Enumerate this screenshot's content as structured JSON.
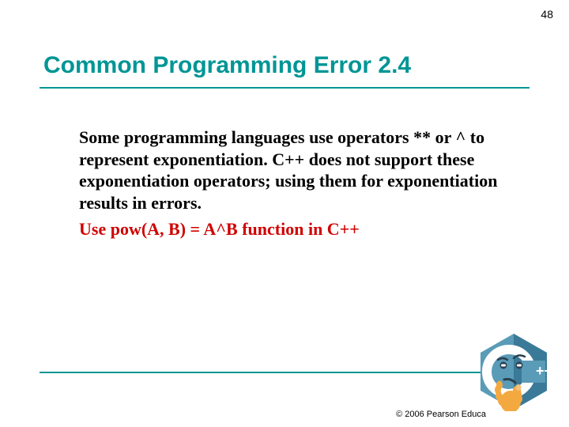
{
  "page_number": "48",
  "title": "Common Programming Error 2.4",
  "paragraph": {
    "p1": "Some programming languages use operators ",
    "op1": "**",
    "p2": " or ",
    "op2": "^",
    "p3": " to represent exponentiation. C++ does not support these exponentiation operators; using them for exponentiation results in errors."
  },
  "hint": "Use pow(A, B) = A^B function in C++",
  "copyright": "© 2006 Pearson Educa",
  "icon": {
    "name": "cpp-thinking-icon",
    "badge": "++"
  },
  "colors": {
    "accent": "#009595",
    "hint": "#d00000"
  }
}
